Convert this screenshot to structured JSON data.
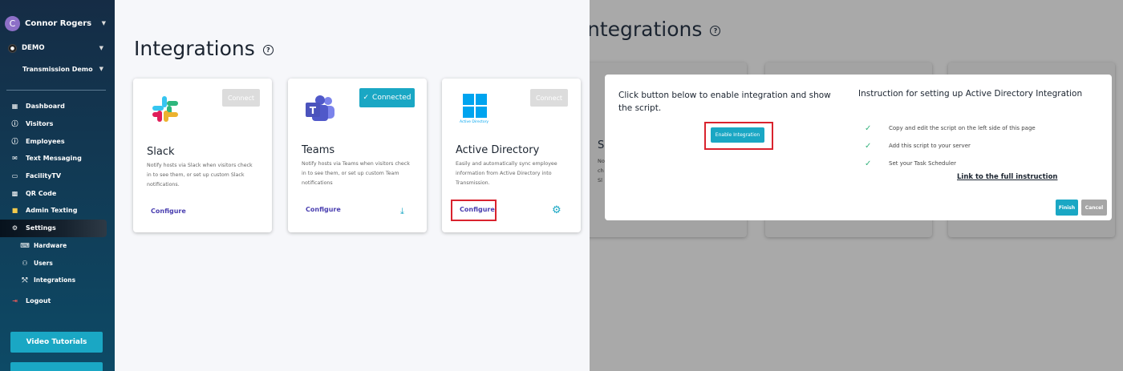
{
  "sidebar": {
    "user_initial": "C",
    "user_name": "Connor Rogers",
    "org": "DEMO",
    "location": "Transmission Demo",
    "nav": [
      {
        "label": "Dashboard",
        "icon": "dashboard-icon"
      },
      {
        "label": "Visitors",
        "icon": "visitors-icon"
      },
      {
        "label": "Employees",
        "icon": "employees-icon"
      },
      {
        "label": "Text Messaging",
        "icon": "text-messaging-icon"
      },
      {
        "label": "FacilityTV",
        "icon": "tv-icon"
      },
      {
        "label": "QR Code",
        "icon": "qr-code-icon"
      },
      {
        "label": "Admin Texting",
        "icon": "admin-texting-icon"
      },
      {
        "label": "Settings",
        "icon": "gear-icon"
      }
    ],
    "settings_sub": [
      {
        "label": "Hardware",
        "icon": "hardware-icon"
      },
      {
        "label": "Users",
        "icon": "users-icon"
      },
      {
        "label": "Integrations",
        "icon": "integrations-icon"
      }
    ],
    "logout": "Logout",
    "video_tutorials": "Video Tutorials"
  },
  "page": {
    "title": "Integrations",
    "help": "?"
  },
  "cards": {
    "slack": {
      "title": "Slack",
      "desc": "Notify hosts via Slack when visitors check in to see them, or set up custom Slack notifications.",
      "connect": "Connect",
      "configure": "Configure"
    },
    "teams": {
      "title": "Teams",
      "desc": "Notify hosts via Teams when visitors check in to see them, or set up custom Team notifications",
      "connected": "Connected",
      "configure": "Configure"
    },
    "ad": {
      "title": "Active Directory",
      "logo_text": "Active Directory",
      "desc": "Easily and automatically sync employee information from Active Directory into Transmission.",
      "connect": "Connect",
      "configure": "Configure"
    }
  },
  "overlay": {
    "ghost_title": "ntegrations",
    "ghost_letter": "S",
    "ghost_lines": [
      "No",
      "ch",
      "Sl"
    ]
  },
  "modal": {
    "left_text": "Click button below to enable integration and show the script.",
    "enable": "Enable Integration",
    "right_title": "Instruction for setting up Active Directory Integration",
    "steps": [
      "Copy and edit the script on the left side of this page",
      "Add this script to your server",
      "Set your Task Scheduler"
    ],
    "link": "Link to the full instruction",
    "finish": "Finish",
    "cancel": "Cancel"
  },
  "colors": {
    "accent": "#1aa7c4",
    "configure": "#4a3fb0",
    "highlight": "#d9232e"
  }
}
